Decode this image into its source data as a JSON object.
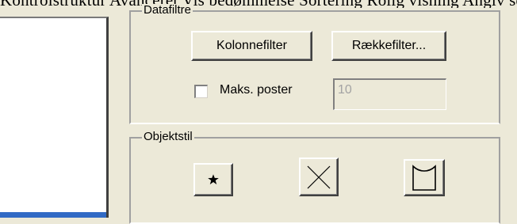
{
  "top_text": "Kontrolstruktur  Avanceret  Vis bedømmelse  Sortering  Rolig visning  Angiv seriernes rækkefølge og udseende på diagrammet  Delt ved  Angiv størrelse på diagrammet",
  "datafiltre": {
    "title": "Datafiltre",
    "kolonnefilter_label": "Kolonnefilter",
    "raekkefilter_label": "Rækkefilter...",
    "max_posts_label": "Maks. poster",
    "max_posts_value": "10",
    "max_posts_checked": false
  },
  "objektstil": {
    "title": "Objektstil",
    "buttons": [
      {
        "icon": "star-icon"
      },
      {
        "icon": "x-icon"
      },
      {
        "icon": "banner-icon"
      }
    ]
  }
}
